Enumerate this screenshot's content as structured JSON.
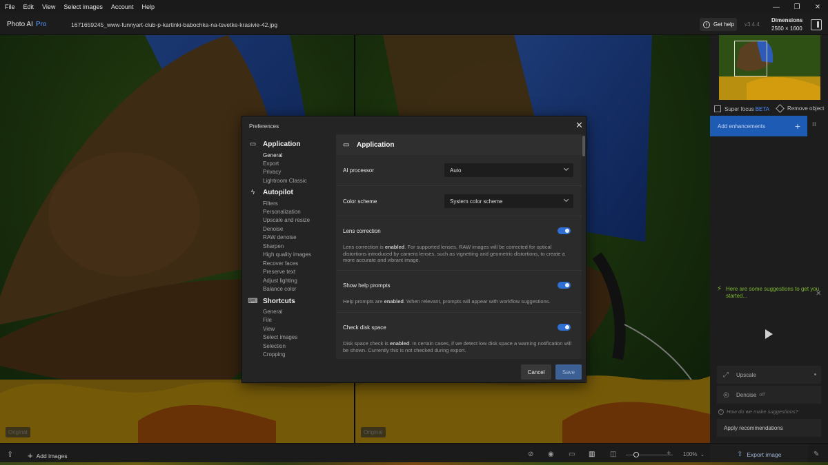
{
  "menu": [
    "File",
    "Edit",
    "View",
    "Select images",
    "Account",
    "Help"
  ],
  "window_controls": [
    "—",
    "❐",
    "✕"
  ],
  "app": {
    "name": "Photo AI",
    "tier": "Pro"
  },
  "file": {
    "name": "1671659245_www-funnyart-club-p-kartinki-babochka-na-tsvetke-krasivie-42.jpg"
  },
  "header": {
    "get_help": "Get help",
    "version": "v3.4.4",
    "dims_label": "Dimensions",
    "dims_value": "2560 × 1600"
  },
  "canvas": {
    "left_tag": "Original",
    "right_tag": "Original"
  },
  "right_panel": {
    "super_focus": "Super focus",
    "beta": "BETA",
    "remove_object": "Remove object",
    "add_enhancements": "Add enhancements",
    "suggestion": "Here are some suggestions to get you started...",
    "rec_upscale": "Upscale",
    "rec_denoise": "Denoise",
    "rec_denoise_note": "off",
    "how": "How do we make suggestions?",
    "apply": "Apply recommendations"
  },
  "bottom": {
    "add_images": "Add images",
    "zoom": "100%",
    "export": "Export image"
  },
  "dialog": {
    "title": "Preferences",
    "close": "✕",
    "nav": {
      "application": {
        "title": "Application",
        "items": [
          "General",
          "Export",
          "Privacy",
          "Lightroom Classic"
        ]
      },
      "autopilot": {
        "title": "Autopilot",
        "items": [
          "Filters",
          "Personalization",
          "Upscale and resize",
          "Denoise",
          "RAW denoise",
          "Sharpen",
          "High quality images",
          "Recover faces",
          "Preserve text",
          "Adjust lighting",
          "Balance color"
        ]
      },
      "shortcuts": {
        "title": "Shortcuts",
        "items": [
          "General",
          "File",
          "View",
          "Select images",
          "Selection",
          "Cropping"
        ]
      }
    },
    "content": {
      "heading": "Application",
      "ai_processor": {
        "label": "AI processor",
        "value": "Auto"
      },
      "color_scheme": {
        "label": "Color scheme",
        "value": "System color scheme"
      },
      "lens": {
        "label": "Lens correction",
        "enabled": true,
        "desc_prefix": "Lens correction is ",
        "desc_state": "enabled",
        "desc_rest": ". For supported lenses, RAW images will be corrected for optical distortions introduced by camera lenses, such as vignetting and geometric distortions, to create a more accurate and vibrant image."
      },
      "help_prompts": {
        "label": "Show help prompts",
        "enabled": true,
        "desc_prefix": "Help prompts are ",
        "desc_state": "enabled",
        "desc_rest": ". When relevant, prompts will appear with workflow suggestions."
      },
      "disk": {
        "label": "Check disk space",
        "enabled": true,
        "desc_prefix": "Disk space check is ",
        "desc_state": "enabled",
        "desc_rest": ". In certain cases, if we detect low disk space a warning notification will be shown. Currently this is not checked during export."
      }
    },
    "cancel": "Cancel",
    "save": "Save"
  },
  "colors": {
    "accent": "#2f6fd3",
    "add_enhancements_bg": "#1e5bb5",
    "suggestion": "#7fb832",
    "beta": "#4c8dff"
  }
}
